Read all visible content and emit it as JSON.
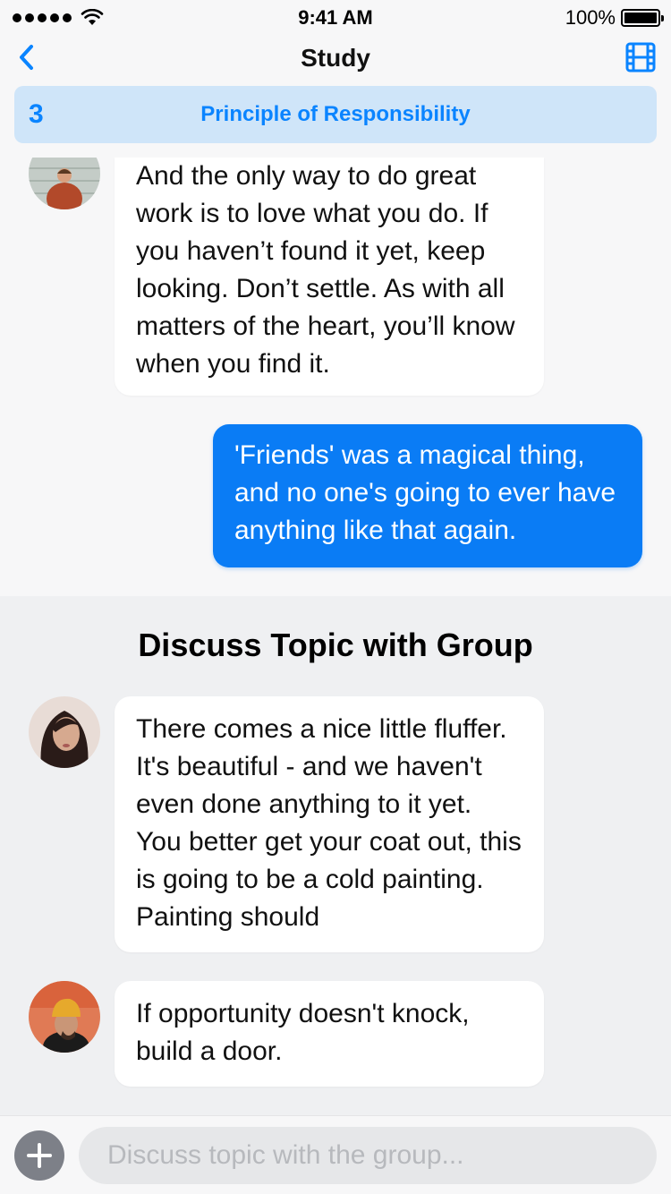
{
  "status_bar": {
    "time": "9:41 AM",
    "battery_percent": "100%",
    "signal_bars": 5,
    "battery_level": 1.0,
    "icons": [
      "signal-dots-icon",
      "wifi-icon",
      "battery-icon"
    ]
  },
  "nav": {
    "title": "Study",
    "back_icon": "chevron-left-icon",
    "right_icon": "film-icon",
    "accent": "#0a84ff"
  },
  "topic": {
    "number": "3",
    "title": "Principle of Responsibility",
    "background": "#cfe5f9"
  },
  "study_messages": [
    {
      "sender": "incoming",
      "text": "And the only way to do great work is to love what you do. If you haven’t found it yet, keep looking. Don’t settle. As with all matters of the heart, you’ll know when you find it.",
      "avatar": "avatar-man-red-jacket"
    },
    {
      "sender": "outgoing",
      "text": "'Friends' was a magical thing, and no one's going to ever have anything like that again.",
      "bubble_color": "#0a7cf5"
    }
  ],
  "group": {
    "title": "Discuss Topic with Group",
    "messages": [
      {
        "text": "There comes a nice little fluffer. It's beautiful - and we haven't even done anything to it yet. You better get your coat out, this is going to be a cold painting. Painting should",
        "avatar": "avatar-woman-dark-hair"
      },
      {
        "text": "If opportunity doesn't knock, build a door.",
        "avatar": "avatar-man-yellow-beanie"
      }
    ]
  },
  "composer": {
    "placeholder": "Discuss topic with the group...",
    "add_icon": "plus-icon"
  }
}
